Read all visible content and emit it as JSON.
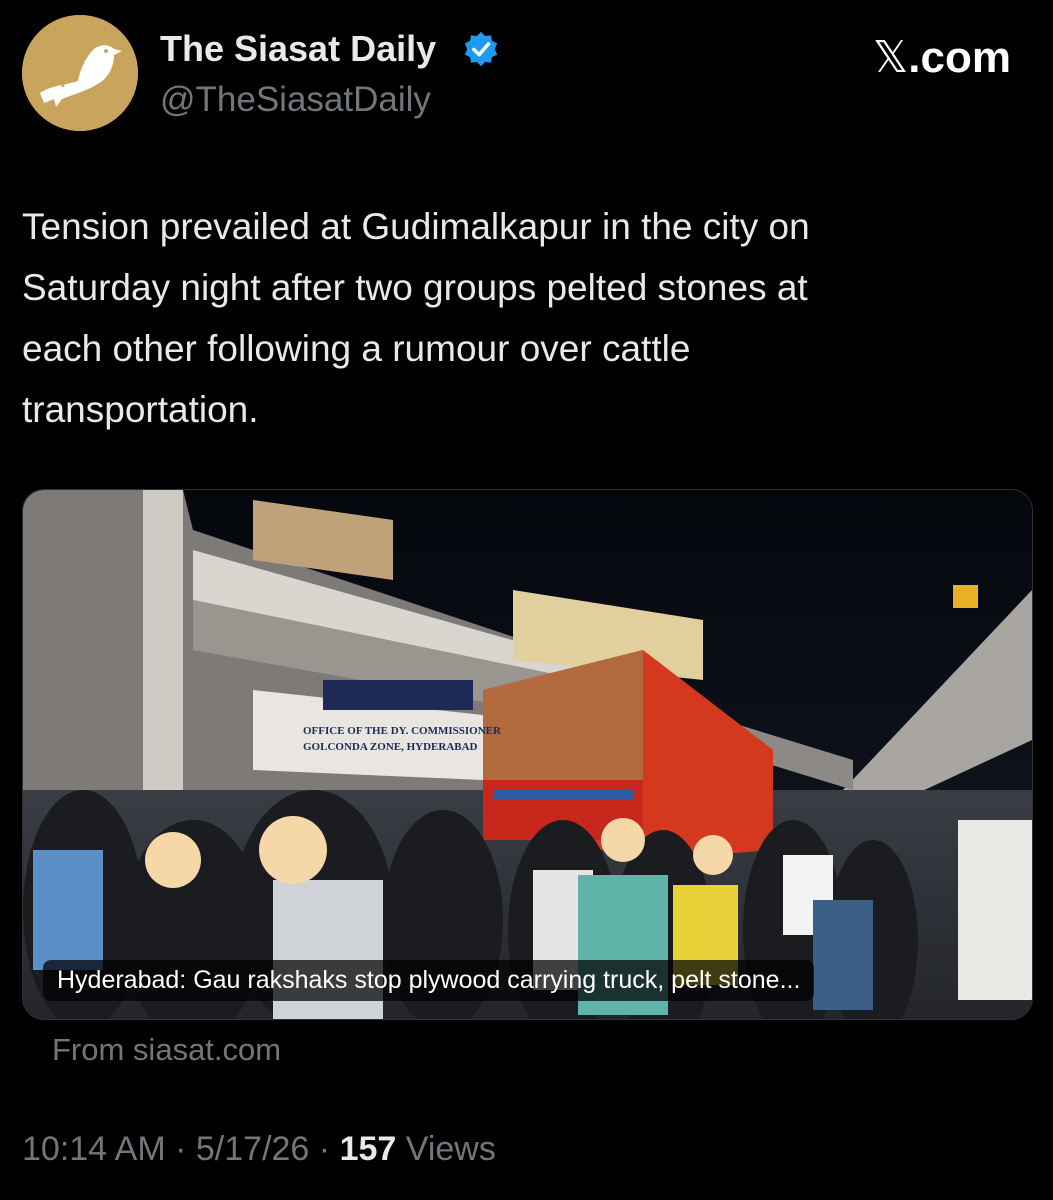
{
  "author": {
    "display_name": "The Siasat Daily",
    "handle": "@TheSiasatDaily",
    "avatar_icon": "dove-logo-icon",
    "avatar_bg": "#c9a45c",
    "verified_icon": "verified-badge-icon",
    "verified_color": "#1d9bf0"
  },
  "brand": {
    "x_glyph": "𝕏",
    "suffix": ".com"
  },
  "tweet": {
    "text": "Tension prevailed at Gudimalkapur in the city on\nSaturday night after two groups pelted stones at\neach other following a rumour over cattle\ntransportation."
  },
  "link_card": {
    "caption": "Hyderabad: Gau rakshaks stop plywood carrying truck, pelt stone...",
    "source": "From siasat.com",
    "image": {
      "sign_line_1": "OFFICE OF THE DY. COMMISSIONER",
      "sign_line_2": "GOLCONDA ZONE, HYDERABAD"
    }
  },
  "meta": {
    "time": "10:14 AM",
    "separator": "·",
    "date": "5/17/26",
    "views_count": "157",
    "views_label": "Views"
  }
}
